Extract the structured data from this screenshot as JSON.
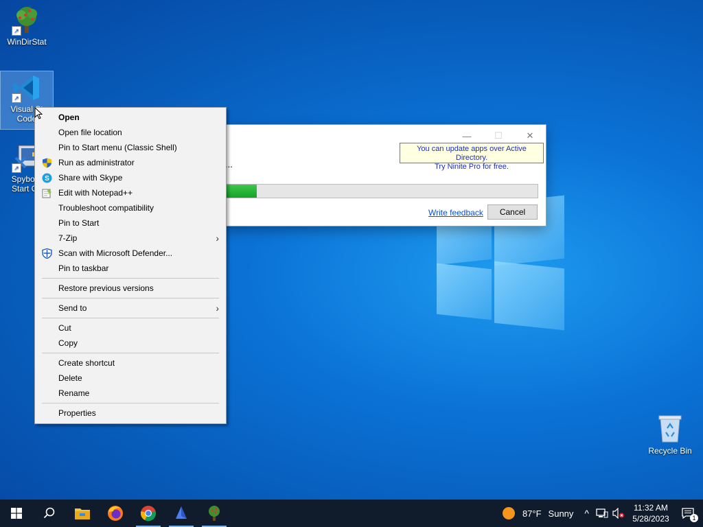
{
  "desktop": {
    "icons": [
      {
        "label": "WinDirStat"
      },
      {
        "label": "Visual Studio Code",
        "label_line1": "Visual St",
        "label_line2": "Code"
      },
      {
        "label": "Spybot - Start Center",
        "label_line1": "Spybot -",
        "label_line2": "Start Ce"
      }
    ],
    "recycle_bin": "Recycle Bin"
  },
  "ninite": {
    "minimize": "—",
    "maximize": "☐",
    "close": "✕",
    "tooltip_line1": "You can update apps over Active Directory.",
    "tooltip_line2": "Try Ninite Pro for free.",
    "status_text": "...",
    "progress": 0.1,
    "feedback_label": "Write feedback",
    "cancel_label": "Cancel"
  },
  "context_menu": {
    "items": [
      {
        "label": "Open"
      },
      {
        "label": "Open file location"
      },
      {
        "label": "Pin to Start menu (Classic Shell)"
      },
      {
        "label": "Run as administrator"
      },
      {
        "label": "Share with Skype"
      },
      {
        "label": "Edit with Notepad++"
      },
      {
        "label": "Troubleshoot compatibility"
      },
      {
        "label": "Pin to Start"
      },
      {
        "label": "7-Zip"
      },
      {
        "label": "Scan with Microsoft Defender..."
      },
      {
        "label": "Pin to taskbar"
      },
      {
        "label": "Restore previous versions"
      },
      {
        "label": "Send to"
      },
      {
        "label": "Cut"
      },
      {
        "label": "Copy"
      },
      {
        "label": "Create shortcut"
      },
      {
        "label": "Delete"
      },
      {
        "label": "Rename"
      },
      {
        "label": "Properties"
      }
    ],
    "submenu_arrow": "›"
  },
  "taskbar": {
    "apps": [
      "start-icon",
      "search-icon",
      "file-explorer-icon",
      "firefox-icon",
      "chrome-icon",
      "app-icon",
      "windirstat-icon"
    ],
    "weather_temp": "87°F",
    "weather_desc": "Sunny",
    "tray_chevron": "^",
    "time": "11:32 AM",
    "date": "5/28/2023",
    "notification_count": "1"
  },
  "colors": {
    "accent": "#0b73d6",
    "progress": "#14a326",
    "taskbar": "#101c2c",
    "link": "#0b4fd6"
  }
}
